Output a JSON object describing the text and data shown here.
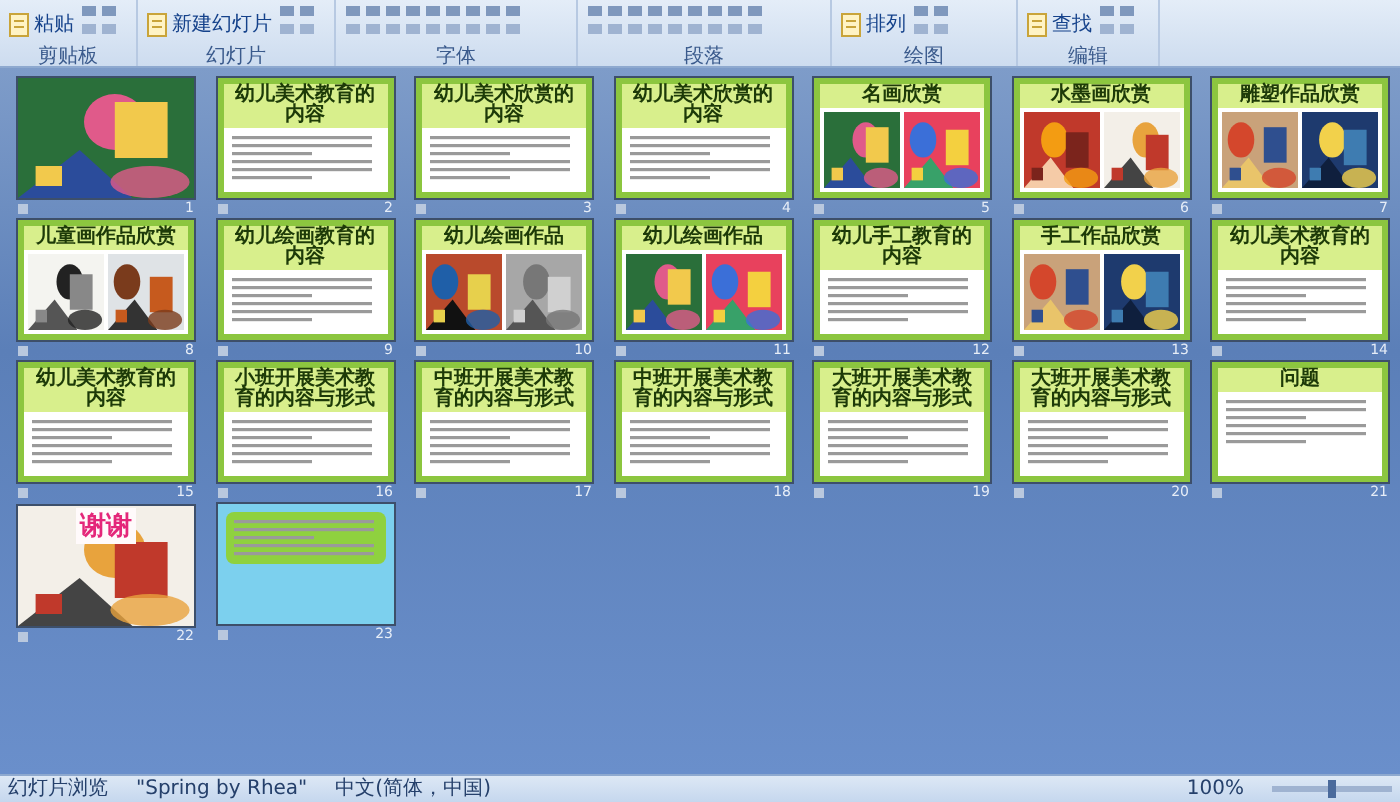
{
  "ribbon": {
    "groups": [
      {
        "label": "剪贴板",
        "button": "粘贴"
      },
      {
        "label": "幻灯片",
        "button": "新建幻灯片"
      },
      {
        "label": "字体"
      },
      {
        "label": "段落"
      },
      {
        "label": "绘图",
        "button": "排列"
      },
      {
        "label": "编辑",
        "button": "查找"
      }
    ]
  },
  "slides": [
    {
      "number": "1",
      "kind": "title"
    },
    {
      "number": "2",
      "kind": "text",
      "title": "幼儿美术教育的内容"
    },
    {
      "number": "3",
      "kind": "text",
      "title": "幼儿美术欣赏的内容"
    },
    {
      "number": "4",
      "kind": "text",
      "title": "幼儿美术欣赏的内容"
    },
    {
      "number": "5",
      "kind": "pictures",
      "title": "名画欣赏"
    },
    {
      "number": "6",
      "kind": "pictures",
      "title": "水墨画欣赏"
    },
    {
      "number": "7",
      "kind": "pictures",
      "title": "雕塑作品欣赏"
    },
    {
      "number": "8",
      "kind": "pictures",
      "title": "儿童画作品欣赏"
    },
    {
      "number": "9",
      "kind": "text",
      "title": "幼儿绘画教育的内容"
    },
    {
      "number": "10",
      "kind": "pictures",
      "title": "幼儿绘画作品"
    },
    {
      "number": "11",
      "kind": "pictures",
      "title": "幼儿绘画作品"
    },
    {
      "number": "12",
      "kind": "text",
      "title": "幼儿手工教育的内容"
    },
    {
      "number": "13",
      "kind": "pictures",
      "title": "手工作品欣赏"
    },
    {
      "number": "14",
      "kind": "text",
      "title": "幼儿美术教育的内容"
    },
    {
      "number": "15",
      "kind": "text",
      "title": "幼儿美术教育的内容"
    },
    {
      "number": "16",
      "kind": "text",
      "title": "小班开展美术教育的内容与形式"
    },
    {
      "number": "17",
      "kind": "text",
      "title": "中班开展美术教育的内容与形式"
    },
    {
      "number": "18",
      "kind": "text",
      "title": "中班开展美术教育的内容与形式"
    },
    {
      "number": "19",
      "kind": "text",
      "title": "大班开展美术教育的内容与形式"
    },
    {
      "number": "20",
      "kind": "text",
      "title": "大班开展美术教育的内容与形式"
    },
    {
      "number": "21",
      "kind": "text",
      "title": "问题"
    },
    {
      "number": "22",
      "kind": "thanks",
      "title": "谢谢"
    },
    {
      "number": "23",
      "kind": "info"
    }
  ],
  "status_bar": {
    "view": "幻灯片浏览",
    "theme": "\"Spring by Rhea\"",
    "language": "中文(简体，中国)",
    "zoom": "100%",
    "zoom_slider": {
      "level": 0.5
    }
  }
}
